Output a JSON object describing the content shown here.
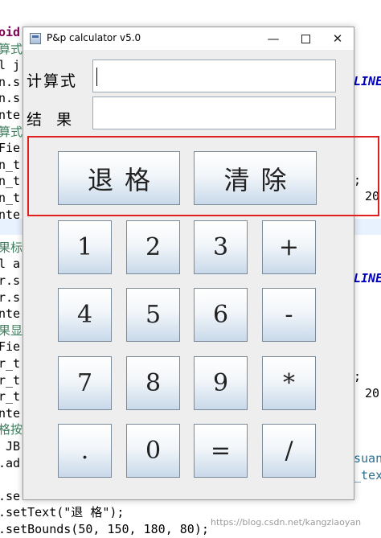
{
  "editor": {
    "lines": [
      {
        "text": "oid",
        "cls": "bold"
      },
      {
        "text": "算式",
        "cls": "green"
      },
      {
        "text": "l j",
        "cls": ""
      },
      {
        "text": "n.s",
        "cls": ""
      },
      {
        "text": "n.s",
        "cls": ""
      },
      {
        "text": "nte",
        "cls": ""
      },
      {
        "text": "算式",
        "cls": "green"
      },
      {
        "text": "Fie",
        "cls": ""
      },
      {
        "text": "n_t",
        "cls": ""
      },
      {
        "text": "n_t",
        "cls": ""
      },
      {
        "text": "n_t",
        "cls": ""
      },
      {
        "text": "nte",
        "cls": ""
      },
      {
        "text": "",
        "cls": ""
      },
      {
        "text": "果标",
        "cls": "green"
      },
      {
        "text": "l a",
        "cls": ""
      },
      {
        "text": "r.s",
        "cls": ""
      },
      {
        "text": "r.s",
        "cls": ""
      },
      {
        "text": "nte",
        "cls": ""
      },
      {
        "text": "果显",
        "cls": "green"
      },
      {
        "text": "Fie",
        "cls": ""
      },
      {
        "text": "r_t",
        "cls": ""
      },
      {
        "text": "r_t",
        "cls": ""
      },
      {
        "text": "r_t",
        "cls": ""
      },
      {
        "text": "nte",
        "cls": ""
      },
      {
        "text": "格按",
        "cls": "green"
      },
      {
        "text": " JB",
        "cls": ""
      },
      {
        "text": ".ad",
        "cls": ""
      },
      {
        "text": "",
        "cls": ""
      },
      {
        "text": ".se",
        "cls": ""
      },
      {
        "text": ".setText(\"退 格\");",
        "cls": ""
      },
      {
        "text": ".setBounds(50, 150, 180, 80);",
        "cls": ""
      }
    ],
    "right_fragments": [
      {
        "text": "LINE",
        "cls": "blue"
      },
      {
        "text": ";",
        "cls": ""
      },
      {
        "text": " 20)",
        "cls": ""
      },
      {
        "text": "LINE",
        "cls": "blue"
      },
      {
        "text": ";",
        "cls": ""
      },
      {
        "text": " 20)",
        "cls": ""
      },
      {
        "text": "suan",
        "cls": "teal"
      },
      {
        "text": "_tex",
        "cls": "teal"
      }
    ],
    "watermark": "https://blog.csdn.net/kangziaoyan"
  },
  "window": {
    "title": "P&p calculator v5.0",
    "controls": {
      "minimize": "—",
      "close": "✕"
    },
    "expression_label": "计算式",
    "result_label": "结  果",
    "expression_value": "",
    "result_value": "",
    "backspace_label": "退格",
    "clear_label": "清除",
    "keys": [
      {
        "label": "1",
        "name": "key-1"
      },
      {
        "label": "2",
        "name": "key-2"
      },
      {
        "label": "3",
        "name": "key-3"
      },
      {
        "label": "+",
        "name": "key-plus"
      },
      {
        "label": "4",
        "name": "key-4"
      },
      {
        "label": "5",
        "name": "key-5"
      },
      {
        "label": "6",
        "name": "key-6"
      },
      {
        "label": "-",
        "name": "key-minus"
      },
      {
        "label": "7",
        "name": "key-7"
      },
      {
        "label": "8",
        "name": "key-8"
      },
      {
        "label": "9",
        "name": "key-9"
      },
      {
        "label": "*",
        "name": "key-multiply"
      },
      {
        "label": ".",
        "name": "key-dot"
      },
      {
        "label": "0",
        "name": "key-0"
      },
      {
        "label": "=",
        "name": "key-equals"
      },
      {
        "label": "/",
        "name": "key-divide"
      }
    ]
  },
  "annotation": {
    "color": "#e02020"
  }
}
